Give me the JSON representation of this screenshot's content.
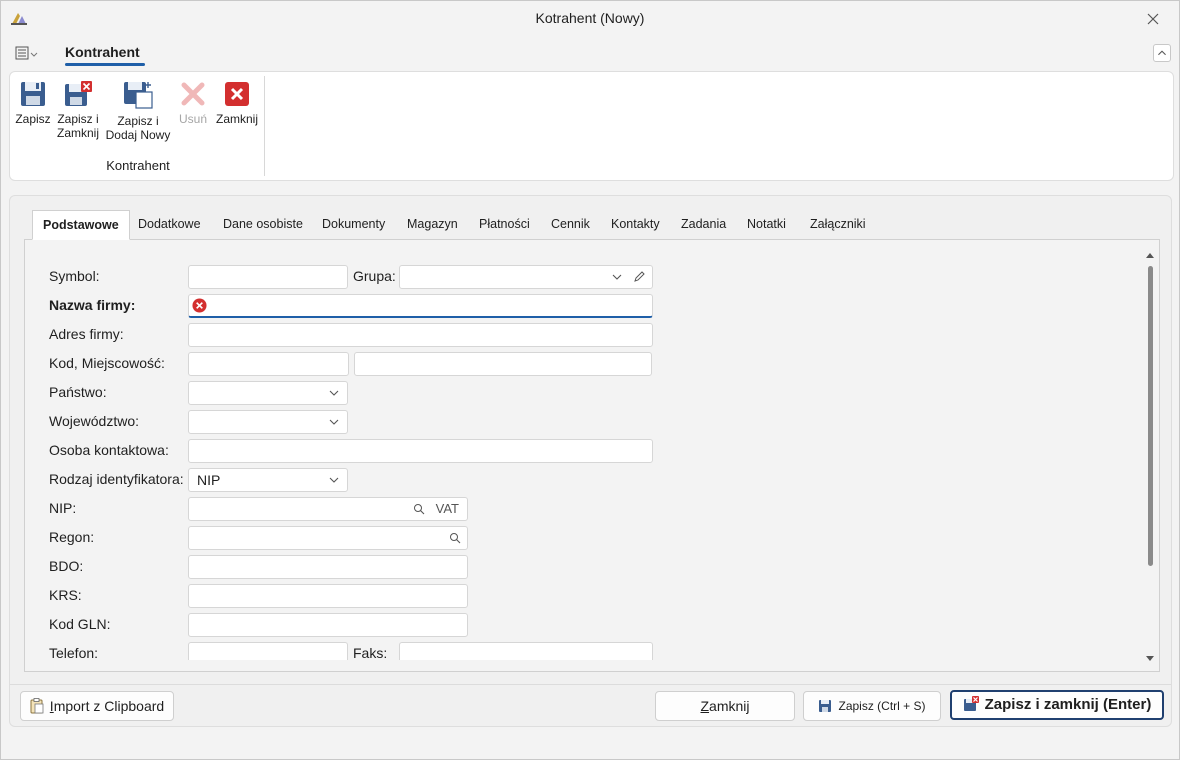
{
  "window": {
    "title": "Kotrahent (Nowy)"
  },
  "ribbon": {
    "tab_label": "Kontrahent",
    "group_label": "Kontrahent",
    "buttons": [
      {
        "label": "Zapisz",
        "icon": "save-icon",
        "enabled": true
      },
      {
        "label": "Zapisz i\nZamknij",
        "icon": "save-close-icon",
        "enabled": true
      },
      {
        "label": "Zapisz i\nDodaj Nowy",
        "icon": "save-new-icon",
        "enabled": true
      },
      {
        "label": "Usuń",
        "icon": "delete-icon",
        "enabled": false
      },
      {
        "label": "Zamknij",
        "icon": "close-red-icon",
        "enabled": true
      }
    ]
  },
  "tabs": [
    "Podstawowe",
    "Dodatkowe",
    "Dane osobiste",
    "Dokumenty",
    "Magazyn",
    "Płatności",
    "Cennik",
    "Kontakty",
    "Zadania",
    "Notatki",
    "Załączniki"
  ],
  "active_tab": "Podstawowe",
  "form": {
    "symbol": {
      "label": "Symbol:",
      "value": ""
    },
    "grupa": {
      "label": "Grupa:",
      "value": ""
    },
    "nazwa_firmy": {
      "label": "Nazwa firmy:",
      "value": "",
      "error": true
    },
    "adres_firmy": {
      "label": "Adres firmy:",
      "value": ""
    },
    "kod_miejscowosc": {
      "label": "Kod, Miejscowość:",
      "kod": "",
      "miejscowosc": ""
    },
    "panstwo": {
      "label": "Państwo:",
      "value": ""
    },
    "wojewodztwo": {
      "label": "Województwo:",
      "value": ""
    },
    "osoba_kontaktowa": {
      "label": "Osoba kontaktowa:",
      "value": ""
    },
    "rodzaj_identyfikatora": {
      "label": "Rodzaj identyfikatora:",
      "value": "NIP"
    },
    "nip": {
      "label": "NIP:",
      "value": "",
      "suffix": "VAT"
    },
    "regon": {
      "label": "Regon:",
      "value": ""
    },
    "bdo": {
      "label": "BDO:",
      "value": ""
    },
    "krs": {
      "label": "KRS:",
      "value": ""
    },
    "kod_gln": {
      "label": "Kod GLN:",
      "value": ""
    },
    "telefon": {
      "label": "Telefon:",
      "value": ""
    },
    "faks": {
      "label": "Faks:",
      "value": ""
    }
  },
  "footer": {
    "import_button": {
      "prefix": "I",
      "rest": "mport z Clipboard"
    },
    "close_button": {
      "prefix": "Z",
      "rest": "amknij"
    },
    "save_button": "Zapisz (Ctrl + S)",
    "save_close_button": "Zapisz i zamknij (Enter)"
  }
}
